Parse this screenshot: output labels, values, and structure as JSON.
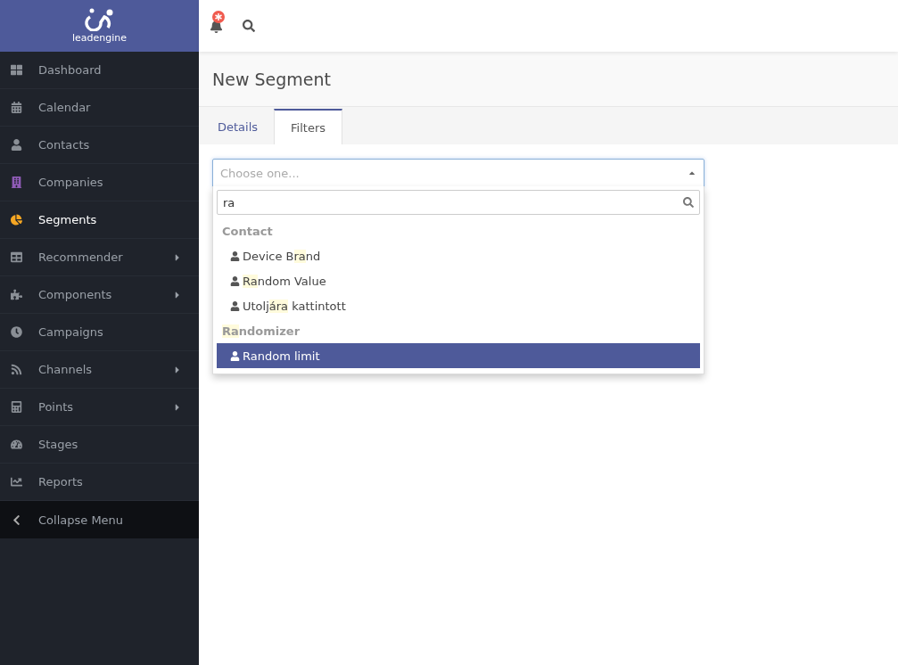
{
  "logo": {
    "text": "leadengine"
  },
  "sidebar": {
    "items": [
      {
        "kind": "dashboard",
        "label": "Dashboard",
        "selected": false,
        "submenu": false
      },
      {
        "kind": "calendar",
        "label": "Calendar",
        "selected": false,
        "submenu": false
      },
      {
        "kind": "contacts",
        "label": "Contacts",
        "selected": false,
        "submenu": false
      },
      {
        "kind": "companies",
        "label": "Companies",
        "selected": false,
        "submenu": false
      },
      {
        "kind": "segments",
        "label": "Segments",
        "selected": true,
        "submenu": false
      },
      {
        "kind": "recommender",
        "label": "Recommender",
        "selected": false,
        "submenu": true
      },
      {
        "kind": "components",
        "label": "Components",
        "selected": false,
        "submenu": true
      },
      {
        "kind": "campaigns",
        "label": "Campaigns",
        "selected": false,
        "submenu": false
      },
      {
        "kind": "channels",
        "label": "Channels",
        "selected": false,
        "submenu": true
      },
      {
        "kind": "points",
        "label": "Points",
        "selected": false,
        "submenu": true
      },
      {
        "kind": "stages",
        "label": "Stages",
        "selected": false,
        "submenu": false
      },
      {
        "kind": "reports",
        "label": "Reports",
        "selected": false,
        "submenu": false
      }
    ],
    "collapse": {
      "label": "Collapse Menu"
    }
  },
  "page": {
    "title": "New Segment"
  },
  "tabs": [
    {
      "label": "Details",
      "selected": false
    },
    {
      "label": "Filters",
      "selected": true
    }
  ],
  "select": {
    "placeholder": "Choose one...",
    "search_value": "ra",
    "groups": [
      {
        "label": [
          {
            "text": "Contact"
          }
        ],
        "options": [
          {
            "parts": [
              {
                "text": "Device B"
              },
              {
                "text": "ra",
                "match": true
              },
              {
                "text": "nd"
              }
            ],
            "selected": false
          },
          {
            "parts": [
              {
                "text": "Ra",
                "match": true
              },
              {
                "text": "ndom Value"
              }
            ],
            "selected": false
          },
          {
            "parts": [
              {
                "text": "Utolj"
              },
              {
                "text": "ára",
                "match": true
              },
              {
                "text": " kattintott"
              }
            ],
            "selected": false
          }
        ]
      },
      {
        "label": [
          {
            "text": "Ra",
            "match": true
          },
          {
            "text": "ndomizer"
          }
        ],
        "options": [
          {
            "parts": [
              {
                "text": "Random limit"
              }
            ],
            "selected": true
          }
        ]
      }
    ]
  }
}
